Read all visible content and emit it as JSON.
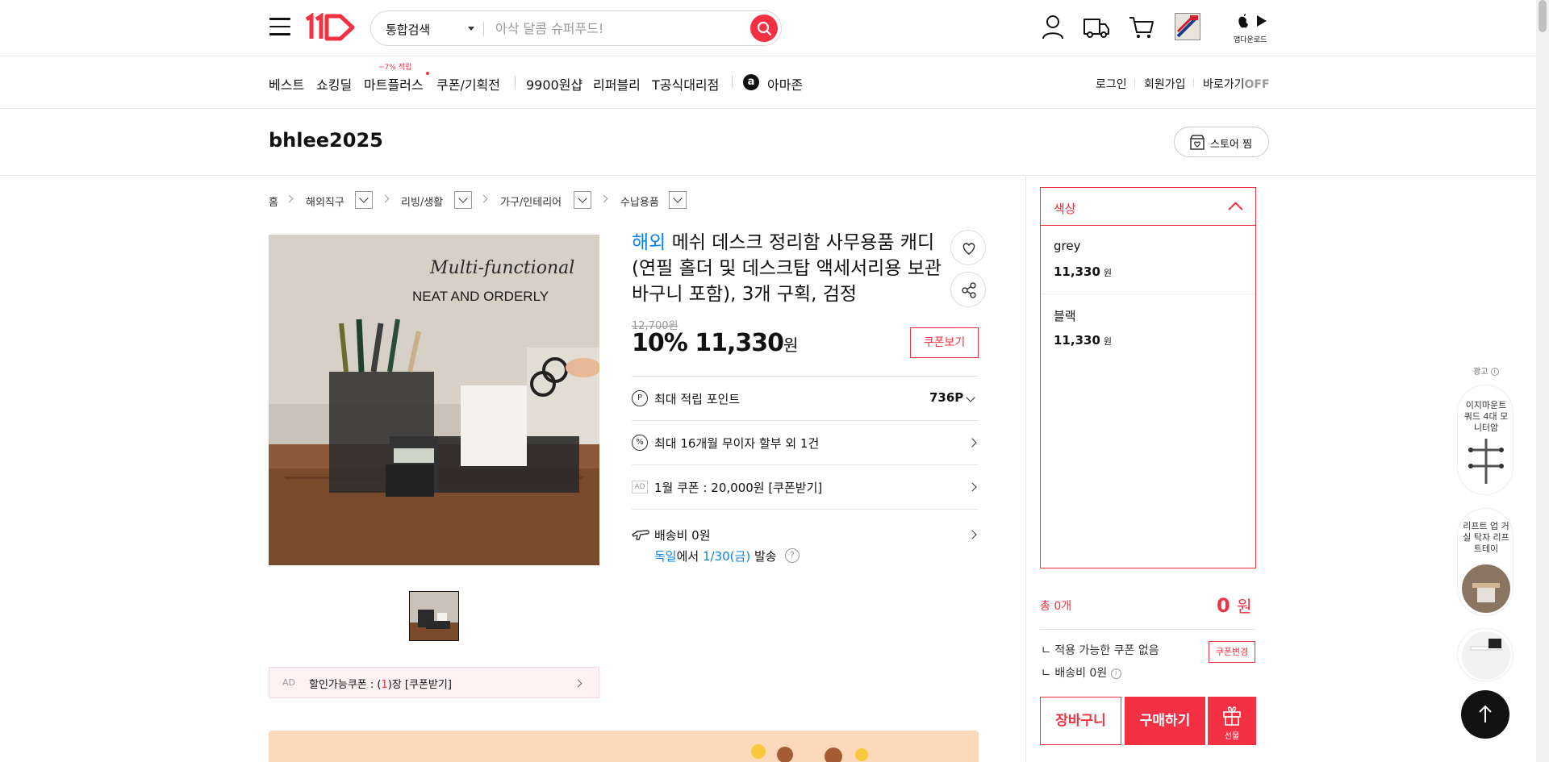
{
  "header": {
    "search_category": "통합검색",
    "search_placeholder": "아삭 달콤 슈퍼푸드!",
    "app_download_label": "앱다운로드"
  },
  "nav": {
    "items": [
      "베스트",
      "쇼킹딜",
      "마트플러스",
      "쿠폰/기획전",
      "9900원샵",
      "리퍼블리",
      "T공식대리점",
      "아마존"
    ],
    "mart_badge": "~7% 적립",
    "login": "로그인",
    "signup": "회원가입",
    "shortcut": "바로가기",
    "shortcut_state": "OFF"
  },
  "store": {
    "name": "bhlee2025",
    "follow_label": "스토어 찜"
  },
  "breadcrumb": [
    "홈",
    "해외직구",
    "리빙/생활",
    "가구/인테리어",
    "수납용품"
  ],
  "product": {
    "overseas_tag": "해외",
    "title": "메쉬 데스크 정리함 사무용품 캐디 (연필 홀더 및 데스크탑 액세서리용 보관 바구니 포함), 3개 구획, 검정",
    "image_text_line1": "Multi-functional",
    "image_text_line2": "NEAT AND ORDERLY",
    "original_price": "12,700원",
    "discount_rate": "10%",
    "price": "11,330",
    "currency": "원",
    "coupon_view_label": "쿠폰보기",
    "points_label": "최대 적립 포인트",
    "points_value": "736P",
    "installment_label": "최대 16개월 무이자 할부 외 1건",
    "ad_coupon_label": "1월 쿠폰 : 20,000원 [쿠폰받기]",
    "ad_tag": "AD",
    "shipping_label": "배송비 0원",
    "shipping_origin": "독일",
    "shipping_mid": "에서",
    "shipping_date": "1/30(금)",
    "shipping_suffix": "발송",
    "discount_coupon_prefix": "할인가능쿠폰 : (",
    "discount_coupon_count": "1",
    "discount_coupon_suffix": ")장 [쿠폰받기]"
  },
  "options": {
    "header": "색상",
    "items": [
      {
        "name": "grey",
        "price": "11,330",
        "unit": "원"
      },
      {
        "name": "블랙",
        "price": "11,330",
        "unit": "원"
      }
    ]
  },
  "summary": {
    "total_count_label": "총 0개",
    "total_price": "0",
    "total_unit": "원",
    "coupon_status": "적용 가능한 쿠폰 없음",
    "coupon_change": "쿠폰변경",
    "shipping": "배송비 0원",
    "cart": "장바구니",
    "buy": "구매하기",
    "gift": "선물"
  },
  "side_ads": {
    "label": "광고",
    "items": [
      {
        "text": "이지마운트 쿼드 4대 모니터암"
      },
      {
        "text": "리프트 업 거실 탁자 리프트테이"
      }
    ]
  },
  "colors": {
    "accent": "#f43142",
    "link_blue": "#0b83e6"
  }
}
